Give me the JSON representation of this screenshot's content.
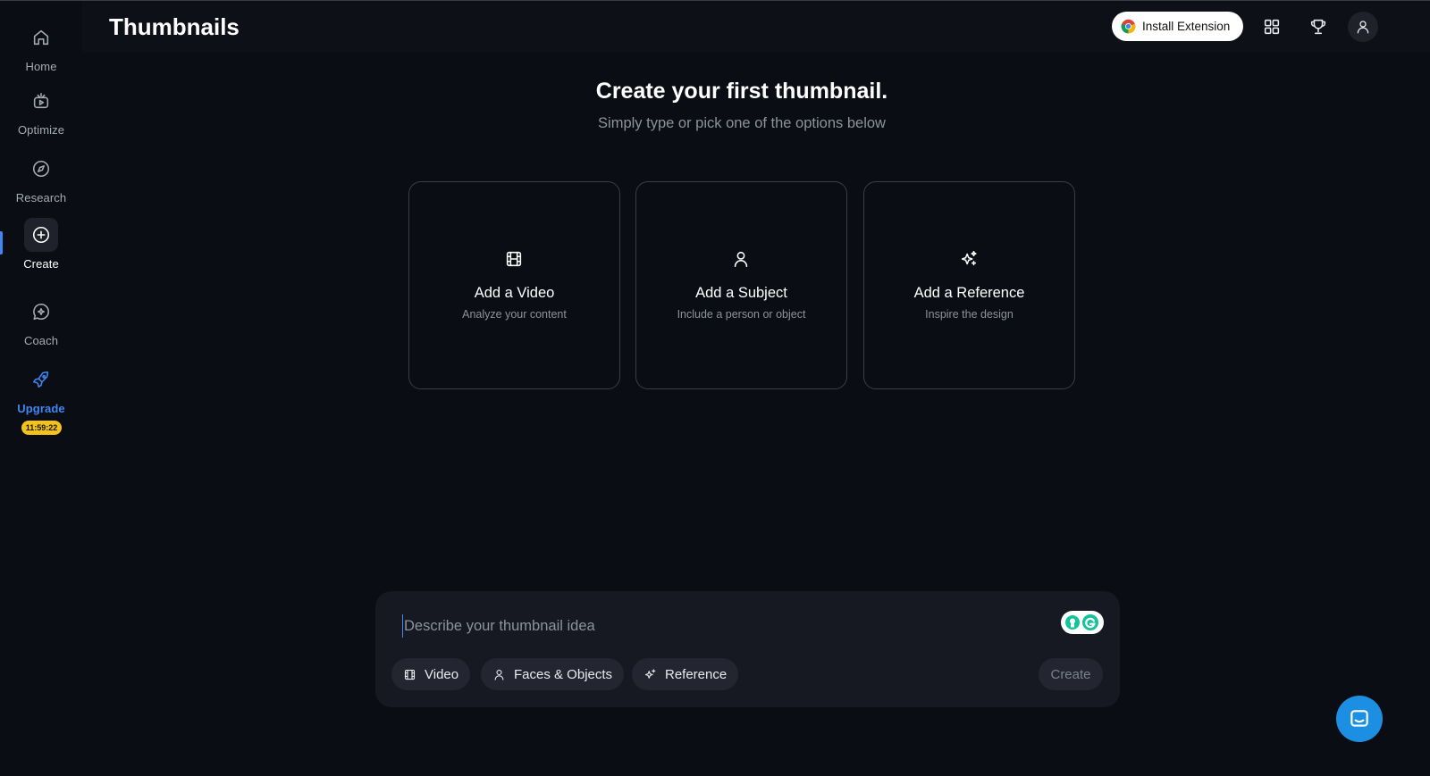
{
  "app": {
    "page_title": "Thumbnails"
  },
  "sidebar": {
    "items": [
      {
        "label": "Home",
        "icon": "home-icon"
      },
      {
        "label": "Optimize",
        "icon": "optimize-icon"
      },
      {
        "label": "Research",
        "icon": "compass-icon"
      },
      {
        "label": "Create",
        "icon": "plus-circle-icon",
        "active": true
      },
      {
        "label": "Coach",
        "icon": "chat-sparkle-icon"
      },
      {
        "label": "Upgrade",
        "icon": "rocket-icon",
        "accent": "#3f86f2"
      }
    ],
    "timer": "11:59:22"
  },
  "header": {
    "install_extension": "Install Extension",
    "icons": [
      "grid-icon",
      "trophy-icon",
      "user-icon"
    ]
  },
  "hero": {
    "title": "Create your first thumbnail.",
    "subtitle": "Simply type or pick one of the options below"
  },
  "cards": [
    {
      "title": "Add a Video",
      "subtitle": "Analyze your content",
      "icon": "film-icon"
    },
    {
      "title": "Add a Subject",
      "subtitle": "Include a person or object",
      "icon": "person-icon"
    },
    {
      "title": "Add a Reference",
      "subtitle": "Inspire the design",
      "icon": "sparkles-icon"
    }
  ],
  "prompt": {
    "placeholder": "Describe your thumbnail idea",
    "value": "",
    "chips": [
      {
        "label": "Video",
        "icon": "film-icon"
      },
      {
        "label": "Faces & Objects",
        "icon": "person-icon"
      },
      {
        "label": "Reference",
        "icon": "sparkles-icon"
      }
    ],
    "create_label": "Create"
  },
  "colors": {
    "background": "#0b0d14",
    "accent": "#3f86f2",
    "timer_badge": "#f3c21b",
    "chat_bubble": "#1d8fe2"
  }
}
